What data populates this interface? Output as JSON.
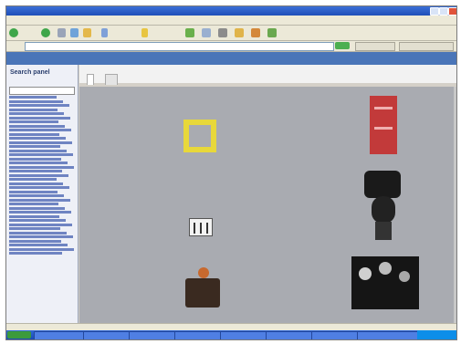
{
  "window": {
    "title": "",
    "menu_items": [
      "",
      "",
      "",
      "",
      "",
      ""
    ]
  },
  "toolbar": {
    "back_label": "",
    "search_label": "",
    "favorites_label": ""
  },
  "address": {
    "label": "",
    "url": "",
    "go_label": ""
  },
  "banner": {
    "logo": "",
    "nav_items": [
      "",
      "",
      "",
      "",
      ""
    ]
  },
  "sidebar": {
    "heading": "Search panel",
    "select_value": "",
    "link_count": 39,
    "bottom_link": ""
  },
  "tabs": {
    "description": "",
    "items": [
      {
        "label": ""
      },
      {
        "label": ""
      }
    ]
  },
  "results": [
    {
      "icon": "yellow-square-icon",
      "caption": ""
    },
    {
      "icon": "red-cabinet-icon",
      "caption": ""
    },
    {
      "icon": "black-sculpture-icon",
      "caption": ""
    },
    {
      "icon": "white-device-icon",
      "caption": ""
    },
    {
      "icon": "figure-with-chest-icon",
      "caption": ""
    },
    {
      "icon": "dark-photo-icon",
      "caption": ""
    }
  ],
  "status": {
    "text": "",
    "zone": ""
  },
  "taskbar": {
    "start_label": "",
    "tasks": [
      "",
      "",
      "",
      "",
      "",
      "",
      "",
      ""
    ],
    "clock": ""
  },
  "colors": {
    "content_bg": "#a9abb1",
    "banner": "#4a75b8",
    "link": "#1f3a93",
    "taskbar": "#1b4ab8"
  }
}
